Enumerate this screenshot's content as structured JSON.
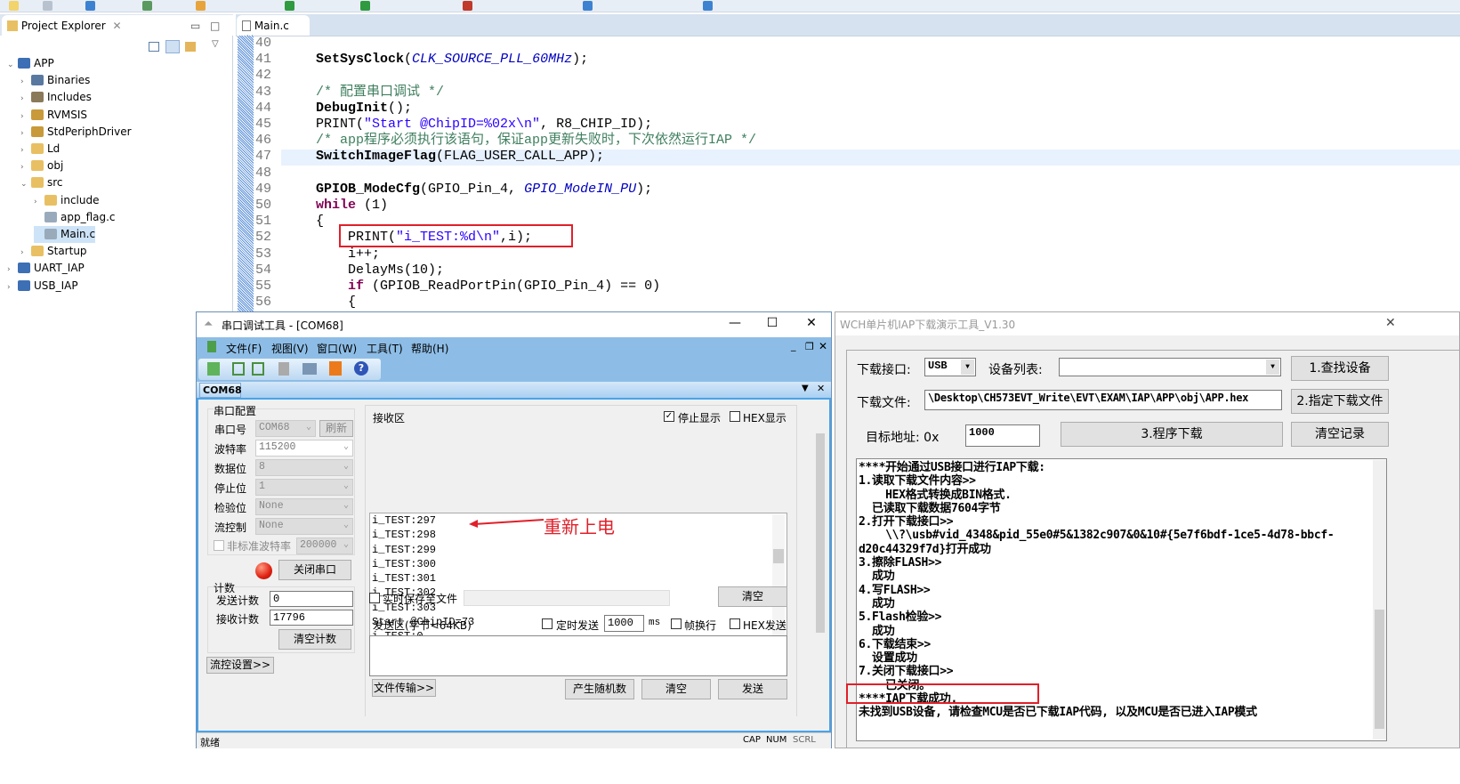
{
  "project_explorer": {
    "title": "Project Explorer",
    "items": [
      {
        "label": "APP",
        "depth": 0,
        "expanded": true,
        "icon": "project-icon"
      },
      {
        "label": "Binaries",
        "depth": 1,
        "icon": "binaries-icon"
      },
      {
        "label": "Includes",
        "depth": 1,
        "icon": "includes-icon"
      },
      {
        "label": "RVMSIS",
        "depth": 1,
        "icon": "source-folder-icon"
      },
      {
        "label": "StdPeriphDriver",
        "depth": 1,
        "icon": "source-folder-icon"
      },
      {
        "label": "Ld",
        "depth": 1,
        "icon": "folder-icon"
      },
      {
        "label": "obj",
        "depth": 1,
        "icon": "folder-icon"
      },
      {
        "label": "src",
        "depth": 1,
        "expanded": true,
        "icon": "folder-icon"
      },
      {
        "label": "include",
        "depth": 2,
        "icon": "folder-icon"
      },
      {
        "label": "app_flag.c",
        "depth": 2,
        "icon": "c-file-icon",
        "leaf": true
      },
      {
        "label": "Main.c",
        "depth": 2,
        "icon": "c-file-icon",
        "leaf": true,
        "selected": true
      },
      {
        "label": "Startup",
        "depth": 1,
        "icon": "folder-icon"
      },
      {
        "label": "UART_IAP",
        "depth": 0,
        "icon": "project-icon"
      },
      {
        "label": "USB_IAP",
        "depth": 0,
        "icon": "project-icon"
      }
    ]
  },
  "editor": {
    "tab": "Main.c",
    "current_line": "47",
    "lines": [
      {
        "n": "40",
        "s": []
      },
      {
        "n": "41",
        "s": [
          {
            "c": "fn",
            "t": "SetSysClock"
          },
          {
            "c": "n",
            "t": "("
          },
          {
            "c": "it",
            "t": "CLK_SOURCE_PLL_60MHz"
          },
          {
            "c": "n",
            "t": ");"
          }
        ]
      },
      {
        "n": "42",
        "s": []
      },
      {
        "n": "43",
        "s": [
          {
            "c": "cm",
            "t": "/* 配置串口调试 */"
          }
        ]
      },
      {
        "n": "44",
        "s": [
          {
            "c": "fn",
            "t": "DebugInit"
          },
          {
            "c": "n",
            "t": "();"
          }
        ]
      },
      {
        "n": "45",
        "s": [
          {
            "c": "n",
            "t": "PRINT("
          },
          {
            "c": "str",
            "t": "\"Start @ChipID=%02x\\n\""
          },
          {
            "c": "n",
            "t": ", R8_CHIP_ID);"
          }
        ]
      },
      {
        "n": "46",
        "s": [
          {
            "c": "cm",
            "t": "/* app程序必须执行该语句，保证app更新失败时，下次依然运行IAP */"
          }
        ]
      },
      {
        "n": "47",
        "s": [
          {
            "c": "fn",
            "t": "SwitchImageFlag"
          },
          {
            "c": "n",
            "t": "(FLAG_USER_CALL_APP);"
          }
        ]
      },
      {
        "n": "48",
        "s": []
      },
      {
        "n": "49",
        "s": [
          {
            "c": "fn",
            "t": "GPIOB_ModeCfg"
          },
          {
            "c": "n",
            "t": "(GPIO_Pin_4, "
          },
          {
            "c": "it",
            "t": "GPIO_ModeIN_PU"
          },
          {
            "c": "n",
            "t": ");"
          }
        ]
      },
      {
        "n": "50",
        "s": [
          {
            "c": "kw",
            "t": "while"
          },
          {
            "c": "n",
            "t": " (1)"
          }
        ]
      },
      {
        "n": "51",
        "s": [
          {
            "c": "n",
            "t": "{"
          }
        ]
      },
      {
        "n": "52",
        "s": [
          {
            "c": "n",
            "t": "    PRINT("
          },
          {
            "c": "str",
            "t": "\"i_TEST:%d\\n\""
          },
          {
            "c": "n",
            "t": ",i);"
          }
        ]
      },
      {
        "n": "53",
        "s": [
          {
            "c": "n",
            "t": "    i++;"
          }
        ]
      },
      {
        "n": "54",
        "s": [
          {
            "c": "n",
            "t": "    DelayMs(10);"
          }
        ]
      },
      {
        "n": "55",
        "s": [
          {
            "c": "n",
            "t": "    "
          },
          {
            "c": "kw",
            "t": "if"
          },
          {
            "c": "n",
            "t": " (GPIOB_ReadPortPin(GPIO_Pin_4) == 0)"
          }
        ]
      },
      {
        "n": "56",
        "s": [
          {
            "c": "n",
            "t": "    {"
          }
        ]
      }
    ]
  },
  "serial": {
    "title": "串口调试工具 - [COM68]",
    "menu": [
      "文件(F)",
      "视图(V)",
      "窗口(W)",
      "工具(T)",
      "帮助(H)"
    ],
    "tab": "COM68",
    "config": {
      "group": "串口配置",
      "port_label": "串口号",
      "port": "COM68",
      "refresh": "刷新",
      "baud_label": "波特率",
      "baud": "115200",
      "data_label": "数据位",
      "data": "8",
      "stop_label": "停止位",
      "stop": "1",
      "parity_label": "检验位",
      "parity": "None",
      "flow_label": "流控制",
      "flow": "None",
      "nonstd_label": "非标准波特率",
      "nonstd": "200000",
      "close_port": "关闭串口"
    },
    "count": {
      "group": "计数",
      "send_label": "发送计数",
      "send": "0",
      "recv_label": "接收计数",
      "recv": "17796",
      "clear": "清空计数"
    },
    "flow_settings": "流控设置>>",
    "rx": {
      "label": "接收区",
      "stop_display": "停止显示",
      "stop_display_checked": true,
      "hex_display": "HEX显示",
      "lines": [
        "i_TEST:297",
        "i_TEST:298",
        "i_TEST:299",
        "i_TEST:300",
        "i_TEST:301",
        "i_TEST:302",
        "i_TEST:303",
        "Start @ChipID=73",
        "i_TEST:0",
        "i_TEST:1",
        "i_TEST:2"
      ]
    },
    "save_realtime": "实时保存至文件",
    "clear_rx": "清空",
    "tx": {
      "label": "发送区(字节<64KB)",
      "timed": "定时发送",
      "interval": "1000",
      "ms": "ms",
      "frame_newline": "帧换行",
      "hex_send": "HEX发送"
    },
    "file_transfer": "文件传输>>",
    "random": "产生随机数",
    "clear_tx": "清空",
    "send": "发送",
    "status": "就绪",
    "indicators": [
      "CAP",
      "NUM",
      "SCRL"
    ],
    "led_color": "#e02010"
  },
  "annotation": {
    "text": "重新上电",
    "color": "#e0202a"
  },
  "iap": {
    "title": "WCH单片机IAP下载演示工具_V1.30",
    "port_label": "下载接口:",
    "port": "USB",
    "device_label": "设备列表:",
    "device": "",
    "find": "1.查找设备",
    "file_label": "下载文件:",
    "file": "\\Desktop\\CH573EVT_Write\\EVT\\EXAM\\IAP\\APP\\obj\\APP.hex",
    "choose_file": "2.指定下载文件",
    "addr_label": "目标地址: 0x",
    "addr": "1000",
    "download": "3.程序下载",
    "clear_log": "清空记录",
    "log": [
      "****开始通过USB接口进行IAP下载:",
      "1.读取下载文件内容>>",
      "    HEX格式转换成BIN格式.",
      "  已读取下载数据7604字节",
      "2.打开下载接口>>",
      "    \\\\?\\usb#vid_4348&pid_55e0#5&1382c907&0&10#{5e7f6bdf-1ce5-4d78-bbcf-",
      "d20c44329f7d}打开成功",
      "3.擦除FLASH>>",
      "  成功",
      "4.写FLASH>>",
      "  成功",
      "5.Flash检验>>",
      "  成功",
      "6.下载结束>>",
      "  设置成功",
      "7.关闭下载接口>>",
      "    已关闭。",
      "****IAP下载成功.",
      "未找到USB设备, 请检查MCU是否已下载IAP代码, 以及MCU是否已进入IAP模式"
    ]
  }
}
